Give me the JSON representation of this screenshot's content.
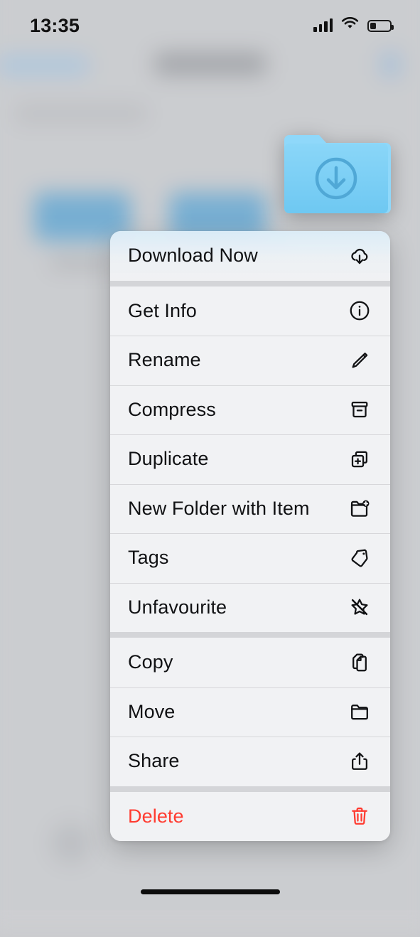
{
  "status_bar": {
    "time": "13:35",
    "signal_icon": "cellular-bars-icon",
    "wifi_icon": "wifi-icon",
    "battery_icon": "battery-low-icon",
    "battery_level_percent": 25
  },
  "preview": {
    "item_name": "downloads-folder",
    "icon": "folder-with-download-arrow-icon",
    "folder_color": "#7ed0f5",
    "folder_color_dark": "#5cb7e0",
    "glyph_color": "#4b9fd0"
  },
  "context_menu": {
    "groups": [
      {
        "items": [
          {
            "label": "Download Now",
            "icon": "cloud-download-icon",
            "destructive": false,
            "tinted": true
          }
        ]
      },
      {
        "items": [
          {
            "label": "Get Info",
            "icon": "info-circle-icon",
            "destructive": false,
            "tinted": false
          },
          {
            "label": "Rename",
            "icon": "pencil-icon",
            "destructive": false,
            "tinted": false
          },
          {
            "label": "Compress",
            "icon": "archive-box-icon",
            "destructive": false,
            "tinted": false
          },
          {
            "label": "Duplicate",
            "icon": "duplicate-plus-icon",
            "destructive": false,
            "tinted": false
          },
          {
            "label": "New Folder with Item",
            "icon": "folder-plus-icon",
            "destructive": false,
            "tinted": false
          },
          {
            "label": "Tags",
            "icon": "tag-icon",
            "destructive": false,
            "tinted": false
          },
          {
            "label": "Unfavourite",
            "icon": "star-slash-icon",
            "destructive": false,
            "tinted": false
          }
        ]
      },
      {
        "items": [
          {
            "label": "Copy",
            "icon": "copy-documents-icon",
            "destructive": false,
            "tinted": false
          },
          {
            "label": "Move",
            "icon": "folder-icon",
            "destructive": false,
            "tinted": false
          },
          {
            "label": "Share",
            "icon": "share-up-arrow-icon",
            "destructive": false,
            "tinted": false
          }
        ]
      },
      {
        "items": [
          {
            "label": "Delete",
            "icon": "trash-icon",
            "destructive": true,
            "tinted": false
          }
        ]
      }
    ],
    "destructive_color": "#ff3b30",
    "label_color": "#111214"
  },
  "home_indicator": {
    "name": "home-indicator"
  }
}
